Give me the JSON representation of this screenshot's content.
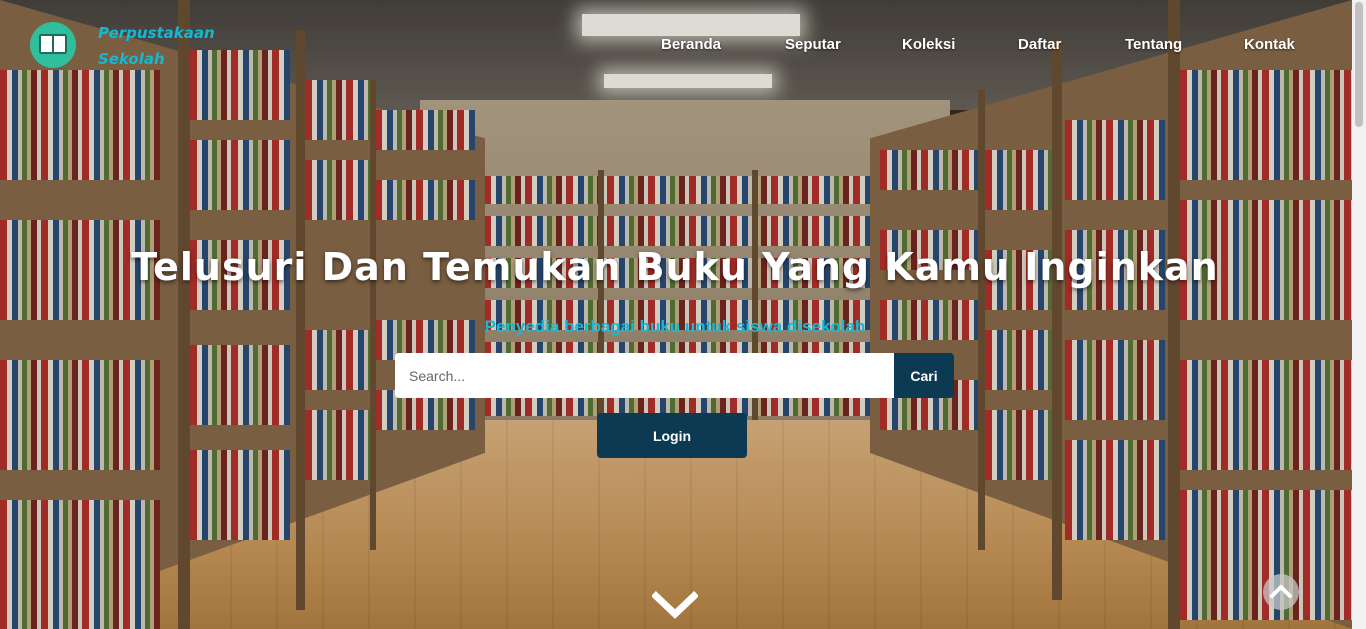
{
  "brand": {
    "line1": "Perpustakaan",
    "line2": "Sekolah",
    "logo_icon": "book-icon",
    "logo_color": "#2fbf9c"
  },
  "nav": {
    "items": [
      {
        "label": "Beranda"
      },
      {
        "label": "Seputar"
      },
      {
        "label": "Koleksi"
      },
      {
        "label": "Daftar"
      },
      {
        "label": "Tentang"
      },
      {
        "label": "Kontak"
      }
    ]
  },
  "hero": {
    "title": "Telusuri Dan Temukan Buku Yang Kamu Inginkan",
    "subtitle": "Penyedia berbagai buku untuk siswa disekolah"
  },
  "search": {
    "placeholder": "Search...",
    "value": "",
    "button_label": "Cari"
  },
  "login": {
    "label": "Login"
  },
  "icons": {
    "scroll_down": "chevron-down-icon",
    "back_to_top": "chevron-up-icon"
  },
  "colors": {
    "accent": "#19b9d6",
    "button": "#0c3a52",
    "brand_text": "#14b8d4"
  }
}
